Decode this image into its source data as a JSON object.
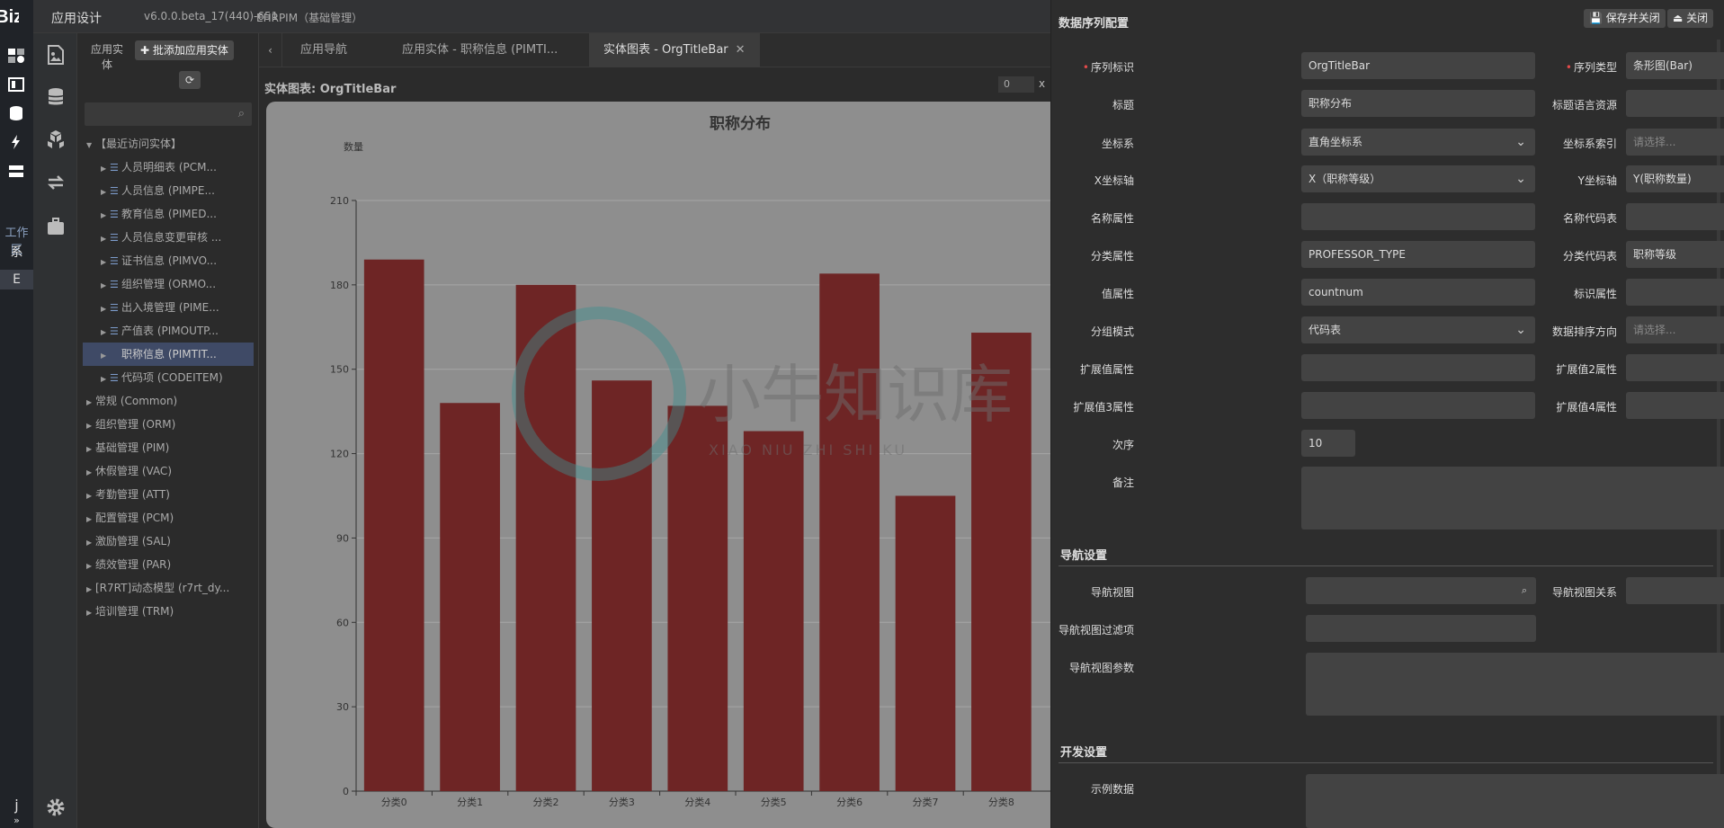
{
  "iconbar": {
    "logo": "eBiz",
    "workspace_label": "工作区",
    "sys_label": "系",
    "e_label": "E",
    "j_label": "j",
    "collapse_label": "»"
  },
  "header": {
    "title": "应用设计",
    "version": "v6.0.0.beta_17(440)-651",
    "system": "EHRPIM（基础管理）"
  },
  "treepanel": {
    "label": "应用实体",
    "add_button": "✚ 批添加应用实体",
    "refresh_icon": "⟳",
    "search_placeholder": "",
    "items": [
      {
        "label": "【最近访问实体】",
        "level": 0,
        "expanded": true
      },
      {
        "label": "人员明细表 (PCM...",
        "level": 1
      },
      {
        "label": "人员信息 (PIMPE...",
        "level": 1
      },
      {
        "label": "教育信息 (PIMED...",
        "level": 1
      },
      {
        "label": "人员信息变更审核 ...",
        "level": 1
      },
      {
        "label": "证书信息 (PIMVO...",
        "level": 1
      },
      {
        "label": "组织管理 (ORMO...",
        "level": 1
      },
      {
        "label": "出入境管理 (PIME...",
        "level": 1
      },
      {
        "label": "产值表 (PIMOUTP...",
        "level": 1
      },
      {
        "label": "职称信息 (PIMTIT...",
        "level": 1,
        "selected": true
      },
      {
        "label": "代码项 (CODEITEM)",
        "level": 1
      },
      {
        "label": "常规 (Common)",
        "level": 0
      },
      {
        "label": "组织管理 (ORM)",
        "level": 0
      },
      {
        "label": "基础管理 (PIM)",
        "level": 0
      },
      {
        "label": "休假管理 (VAC)",
        "level": 0
      },
      {
        "label": "考勤管理 (ATT)",
        "level": 0
      },
      {
        "label": "配置管理 (PCM)",
        "level": 0
      },
      {
        "label": "激励管理 (SAL)",
        "level": 0
      },
      {
        "label": "绩效管理 (PAR)",
        "level": 0
      },
      {
        "label": "[R7RT]动态模型 (r7rt_dy...",
        "level": 0
      },
      {
        "label": "培训管理 (TRM)",
        "level": 0
      }
    ]
  },
  "tabs": [
    {
      "label": "应用导航"
    },
    {
      "label": "应用实体 - 职称信息 (PIMTI..."
    },
    {
      "label": "实体图表 - OrgTitleBar",
      "active": true,
      "close": "✕"
    }
  ],
  "main": {
    "subtitle": "实体图表: OrgTitleBar",
    "zoom_value": "0",
    "zoom_x": "x"
  },
  "chart_data": {
    "type": "bar",
    "title": "职称分布",
    "ylabel": "数量",
    "xlabel": "",
    "categories": [
      "分类0",
      "分类1",
      "分类2",
      "分类3",
      "分类4",
      "分类5",
      "分类6",
      "分类7",
      "分类8"
    ],
    "values": [
      189,
      138,
      180,
      146,
      137,
      128,
      184,
      105,
      163
    ],
    "ylim": [
      0,
      210
    ],
    "yticks": [
      "0",
      "30",
      "60",
      "90",
      "120",
      "150",
      "180",
      "210"
    ],
    "grid": true,
    "bar_color": "#6e2525"
  },
  "watermark": {
    "text": "小牛知识库",
    "subtext": "XIAO NIU ZHI SHI KU"
  },
  "config": {
    "title": "数据序列配置",
    "save_close": "💾 保存并关闭",
    "close": "⏏ 关闭",
    "fields": {
      "series_id_label": "序列标识",
      "series_id_value": "OrgTitleBar",
      "series_type_label": "序列类型",
      "series_type_value": "条形图(Bar)",
      "title_label": "标题",
      "title_value": "职称分布",
      "title_res_label": "标题语言资源",
      "title_res_value": "",
      "coord_label": "坐标系",
      "coord_value": "直角坐标系",
      "coord_idx_label": "坐标系索引",
      "coord_idx_value": "请选择...",
      "xaxis_label": "X坐标轴",
      "xaxis_value": "X（职称等级）",
      "yaxis_label": "Y坐标轴",
      "yaxis_value": "Y(职称数量)",
      "name_attr_label": "名称属性",
      "name_attr_value": "",
      "name_code_label": "名称代码表",
      "name_code_value": "",
      "cat_attr_label": "分类属性",
      "cat_attr_value": "PROFESSOR_TYPE",
      "cat_code_label": "分类代码表",
      "cat_code_value": "职称等级",
      "val_attr_label": "值属性",
      "val_attr_value": "countnum",
      "id_attr_label": "标识属性",
      "id_attr_value": "",
      "group_label": "分组模式",
      "group_value": "代码表",
      "sort_label": "数据排序方向",
      "sort_value": "请选择...",
      "ext1_label": "扩展值属性",
      "ext1_value": "",
      "ext2_label": "扩展值2属性",
      "ext2_value": "",
      "ext3_label": "扩展值3属性",
      "ext3_value": "",
      "ext4_label": "扩展值4属性",
      "ext4_value": "",
      "order_label": "次序",
      "order_value": "10",
      "remark_label": "备注",
      "remark_value": ""
    },
    "nav_section": "导航设置",
    "nav_view_label": "导航视图",
    "nav_view_value": "",
    "nav_rel_label": "导航视图关系",
    "nav_rel_value": "",
    "nav_filter_label": "导航视图过滤项",
    "nav_filter_value": "",
    "nav_params_label": "导航视图参数",
    "nav_params_value": "",
    "dev_section": "开发设置",
    "sample_label": "示例数据",
    "sample_value": "",
    "search_icon": "⌕",
    "chevron_icon": "⌄"
  }
}
